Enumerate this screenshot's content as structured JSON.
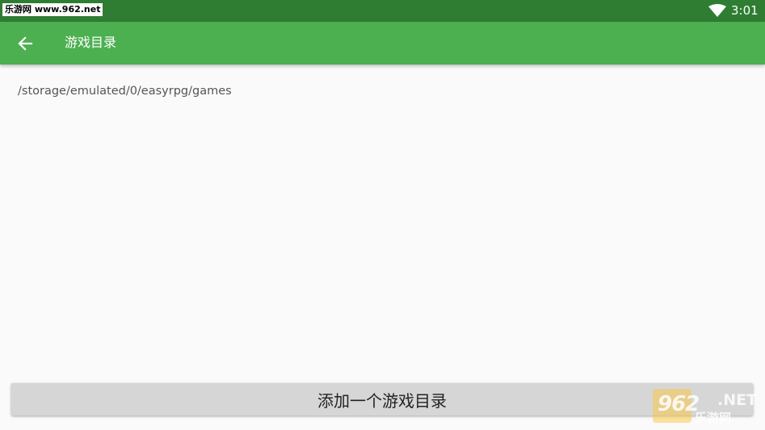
{
  "status_bar": {
    "watermark": "乐游网 www.962.net",
    "time": "3:01",
    "wifi_icon": "wifi-icon",
    "color": "#2e7d32"
  },
  "app_bar": {
    "title": "游戏目录",
    "back_icon": "arrow-left-icon",
    "color": "#4caf50"
  },
  "directories": [
    "/storage/emulated/0/easyrpg/games"
  ],
  "actions": {
    "add_directory_label": "添加一个游戏目录"
  },
  "watermark_logo": {
    "number": "962",
    "suffix": ".NET",
    "site_name": "乐游网"
  }
}
